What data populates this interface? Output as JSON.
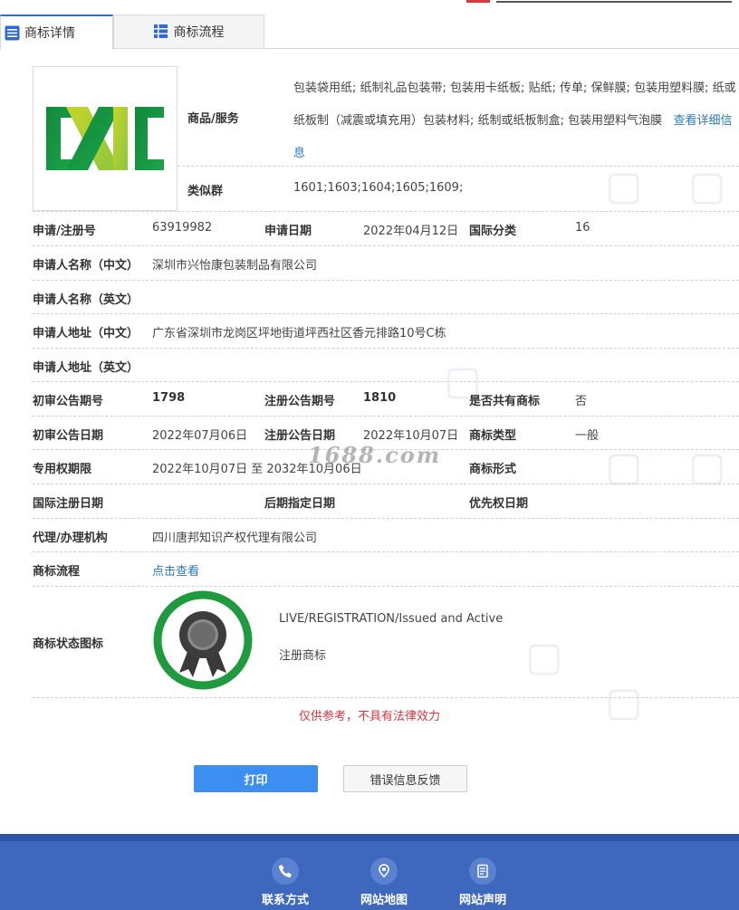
{
  "tabs": [
    {
      "label": "商标详情",
      "active": true
    },
    {
      "label": "商标流程",
      "active": false
    }
  ],
  "goods": {
    "label": "商品/服务",
    "text": "包装袋用纸; 纸制礼品包装带; 包装用卡纸板; 贴纸; 传单; 保鲜膜; 包装用塑料膜; 纸或纸板制（减震或填充用）包装材料; 纸制或纸板制盒; 包装用塑料气泡膜",
    "more_link": "查看详细信息"
  },
  "similar_group": {
    "label": "类似群",
    "value": "1601;1603;1604;1605;1609;"
  },
  "fields": {
    "reg_no": {
      "label": "申请/注册号",
      "value": "63919982"
    },
    "apply_date": {
      "label": "申请日期",
      "value": "2022年04月12日"
    },
    "intl_class": {
      "label": "国际分类",
      "value": "16"
    },
    "applicant_cn": {
      "label": "申请人名称（中文）",
      "value": "深圳市兴怡康包装制品有限公司"
    },
    "applicant_en": {
      "label": "申请人名称（英文）",
      "value": ""
    },
    "address_cn": {
      "label": "申请人地址（中文）",
      "value": "广东省深圳市龙岗区坪地街道坪西社区香元排路10号C栋"
    },
    "address_en": {
      "label": "申请人地址（英文）",
      "value": ""
    },
    "prelim_issue": {
      "label": "初审公告期号",
      "value": "1798"
    },
    "reg_issue": {
      "label": "注册公告期号",
      "value": "1810"
    },
    "shared": {
      "label": "是否共有商标",
      "value": "否"
    },
    "prelim_date": {
      "label": "初审公告日期",
      "value": "2022年07月06日"
    },
    "reg_date": {
      "label": "注册公告日期",
      "value": "2022年10月07日"
    },
    "mark_type": {
      "label": "商标类型",
      "value": "一般"
    },
    "exclusive_period": {
      "label": "专用权期限",
      "value": "2022年10月07日 至 2032年10月06日"
    },
    "mark_form": {
      "label": "商标形式",
      "value": ""
    },
    "intl_reg_date": {
      "label": "国际注册日期",
      "value": ""
    },
    "later_designation": {
      "label": "后期指定日期",
      "value": ""
    },
    "priority_date": {
      "label": "优先权日期",
      "value": ""
    },
    "agent": {
      "label": "代理/办理机构",
      "value": "四川唐邦知识产权代理有限公司"
    },
    "process": {
      "label": "商标流程",
      "value": "点击查看"
    },
    "status_icon": {
      "label": "商标状态图标"
    }
  },
  "status": {
    "en": "LIVE/REGISTRATION/Issued and Active",
    "cn": "注册商标"
  },
  "watermark_overlay": "1688.com",
  "notice": "仅供参考，不具有法律效力",
  "buttons": {
    "print": "打印",
    "feedback": "错误信息反馈"
  },
  "footer": [
    {
      "label": "联系方式",
      "icon": "phone-icon"
    },
    {
      "label": "网站地图",
      "icon": "map-pin-icon"
    },
    {
      "label": "网站声明",
      "icon": "document-icon"
    }
  ],
  "colors": {
    "accent": "#3c8ef0",
    "footer": "#3d68bd",
    "notice": "#d9363e",
    "badge_ring": "#1f9a3f"
  }
}
